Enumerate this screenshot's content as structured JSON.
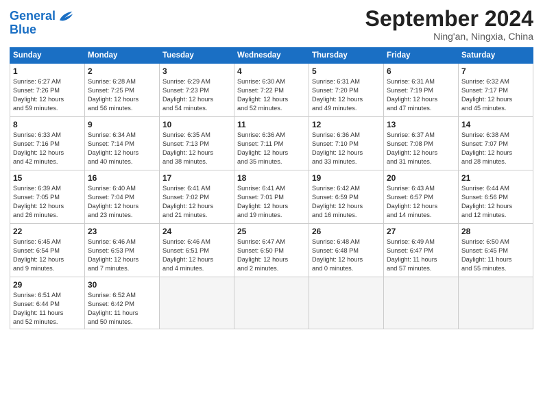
{
  "header": {
    "logo_line1": "General",
    "logo_line2": "Blue",
    "month": "September 2024",
    "location": "Ning'an, Ningxia, China"
  },
  "days_of_week": [
    "Sunday",
    "Monday",
    "Tuesday",
    "Wednesday",
    "Thursday",
    "Friday",
    "Saturday"
  ],
  "weeks": [
    [
      {
        "day": "1",
        "lines": [
          "Sunrise: 6:27 AM",
          "Sunset: 7:26 PM",
          "Daylight: 12 hours",
          "and 59 minutes."
        ]
      },
      {
        "day": "2",
        "lines": [
          "Sunrise: 6:28 AM",
          "Sunset: 7:25 PM",
          "Daylight: 12 hours",
          "and 56 minutes."
        ]
      },
      {
        "day": "3",
        "lines": [
          "Sunrise: 6:29 AM",
          "Sunset: 7:23 PM",
          "Daylight: 12 hours",
          "and 54 minutes."
        ]
      },
      {
        "day": "4",
        "lines": [
          "Sunrise: 6:30 AM",
          "Sunset: 7:22 PM",
          "Daylight: 12 hours",
          "and 52 minutes."
        ]
      },
      {
        "day": "5",
        "lines": [
          "Sunrise: 6:31 AM",
          "Sunset: 7:20 PM",
          "Daylight: 12 hours",
          "and 49 minutes."
        ]
      },
      {
        "day": "6",
        "lines": [
          "Sunrise: 6:31 AM",
          "Sunset: 7:19 PM",
          "Daylight: 12 hours",
          "and 47 minutes."
        ]
      },
      {
        "day": "7",
        "lines": [
          "Sunrise: 6:32 AM",
          "Sunset: 7:17 PM",
          "Daylight: 12 hours",
          "and 45 minutes."
        ]
      }
    ],
    [
      {
        "day": "8",
        "lines": [
          "Sunrise: 6:33 AM",
          "Sunset: 7:16 PM",
          "Daylight: 12 hours",
          "and 42 minutes."
        ]
      },
      {
        "day": "9",
        "lines": [
          "Sunrise: 6:34 AM",
          "Sunset: 7:14 PM",
          "Daylight: 12 hours",
          "and 40 minutes."
        ]
      },
      {
        "day": "10",
        "lines": [
          "Sunrise: 6:35 AM",
          "Sunset: 7:13 PM",
          "Daylight: 12 hours",
          "and 38 minutes."
        ]
      },
      {
        "day": "11",
        "lines": [
          "Sunrise: 6:36 AM",
          "Sunset: 7:11 PM",
          "Daylight: 12 hours",
          "and 35 minutes."
        ]
      },
      {
        "day": "12",
        "lines": [
          "Sunrise: 6:36 AM",
          "Sunset: 7:10 PM",
          "Daylight: 12 hours",
          "and 33 minutes."
        ]
      },
      {
        "day": "13",
        "lines": [
          "Sunrise: 6:37 AM",
          "Sunset: 7:08 PM",
          "Daylight: 12 hours",
          "and 31 minutes."
        ]
      },
      {
        "day": "14",
        "lines": [
          "Sunrise: 6:38 AM",
          "Sunset: 7:07 PM",
          "Daylight: 12 hours",
          "and 28 minutes."
        ]
      }
    ],
    [
      {
        "day": "15",
        "lines": [
          "Sunrise: 6:39 AM",
          "Sunset: 7:05 PM",
          "Daylight: 12 hours",
          "and 26 minutes."
        ]
      },
      {
        "day": "16",
        "lines": [
          "Sunrise: 6:40 AM",
          "Sunset: 7:04 PM",
          "Daylight: 12 hours",
          "and 23 minutes."
        ]
      },
      {
        "day": "17",
        "lines": [
          "Sunrise: 6:41 AM",
          "Sunset: 7:02 PM",
          "Daylight: 12 hours",
          "and 21 minutes."
        ]
      },
      {
        "day": "18",
        "lines": [
          "Sunrise: 6:41 AM",
          "Sunset: 7:01 PM",
          "Daylight: 12 hours",
          "and 19 minutes."
        ]
      },
      {
        "day": "19",
        "lines": [
          "Sunrise: 6:42 AM",
          "Sunset: 6:59 PM",
          "Daylight: 12 hours",
          "and 16 minutes."
        ]
      },
      {
        "day": "20",
        "lines": [
          "Sunrise: 6:43 AM",
          "Sunset: 6:57 PM",
          "Daylight: 12 hours",
          "and 14 minutes."
        ]
      },
      {
        "day": "21",
        "lines": [
          "Sunrise: 6:44 AM",
          "Sunset: 6:56 PM",
          "Daylight: 12 hours",
          "and 12 minutes."
        ]
      }
    ],
    [
      {
        "day": "22",
        "lines": [
          "Sunrise: 6:45 AM",
          "Sunset: 6:54 PM",
          "Daylight: 12 hours",
          "and 9 minutes."
        ]
      },
      {
        "day": "23",
        "lines": [
          "Sunrise: 6:46 AM",
          "Sunset: 6:53 PM",
          "Daylight: 12 hours",
          "and 7 minutes."
        ]
      },
      {
        "day": "24",
        "lines": [
          "Sunrise: 6:46 AM",
          "Sunset: 6:51 PM",
          "Daylight: 12 hours",
          "and 4 minutes."
        ]
      },
      {
        "day": "25",
        "lines": [
          "Sunrise: 6:47 AM",
          "Sunset: 6:50 PM",
          "Daylight: 12 hours",
          "and 2 minutes."
        ]
      },
      {
        "day": "26",
        "lines": [
          "Sunrise: 6:48 AM",
          "Sunset: 6:48 PM",
          "Daylight: 12 hours",
          "and 0 minutes."
        ]
      },
      {
        "day": "27",
        "lines": [
          "Sunrise: 6:49 AM",
          "Sunset: 6:47 PM",
          "Daylight: 11 hours",
          "and 57 minutes."
        ]
      },
      {
        "day": "28",
        "lines": [
          "Sunrise: 6:50 AM",
          "Sunset: 6:45 PM",
          "Daylight: 11 hours",
          "and 55 minutes."
        ]
      }
    ],
    [
      {
        "day": "29",
        "lines": [
          "Sunrise: 6:51 AM",
          "Sunset: 6:44 PM",
          "Daylight: 11 hours",
          "and 52 minutes."
        ]
      },
      {
        "day": "30",
        "lines": [
          "Sunrise: 6:52 AM",
          "Sunset: 6:42 PM",
          "Daylight: 11 hours",
          "and 50 minutes."
        ]
      },
      {
        "day": "",
        "lines": []
      },
      {
        "day": "",
        "lines": []
      },
      {
        "day": "",
        "lines": []
      },
      {
        "day": "",
        "lines": []
      },
      {
        "day": "",
        "lines": []
      }
    ]
  ]
}
